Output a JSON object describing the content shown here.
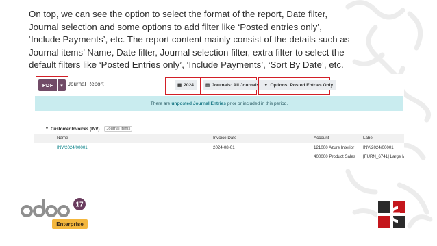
{
  "intro_text": "On top, we can see the option to select the format of the report, Date filter, Journal selection and some options to add filter like ‘Posted entries only’, ‘Include Payments’, etc. The report content mainly consist of the details such as Journal items’ Name, Date filter, Journal selection filter, extra filter to select the default filters like ‘Posted Entries only’, ‘Include Payments’, ‘Sort By Date’, etc.",
  "toolbar": {
    "pdf_label": "PDF",
    "report_title": "Journal Report",
    "date_filter": "2024",
    "journals_filter": "Journals: All Journals",
    "options_filter": "Options: Posted Entries Only"
  },
  "banner": {
    "prefix": "There are",
    "link": "unposted Journal Entries",
    "suffix": "prior or included in this period."
  },
  "section": {
    "title": "Customer Invoices (INV)",
    "badge": "Journal Items"
  },
  "table": {
    "headers": [
      "Name",
      "Invoice Date",
      "Account",
      "Label"
    ],
    "rows": [
      [
        "INV/2024/00001",
        "2024-08-01",
        "121000 Azure Interior",
        "INV/2024/00001"
      ],
      [
        "",
        "",
        "400000 Product Sales",
        "[FURN_6741] Large M"
      ]
    ]
  },
  "branding": {
    "odoo_logo": "odoo",
    "version": "17",
    "edition": "Enterprise"
  },
  "colors": {
    "accent": "#714b67",
    "highlight_box": "#d21f27",
    "banner_bg": "#c9ecef",
    "link": "#017e84",
    "enterprise_badge": "#f4b73d"
  }
}
